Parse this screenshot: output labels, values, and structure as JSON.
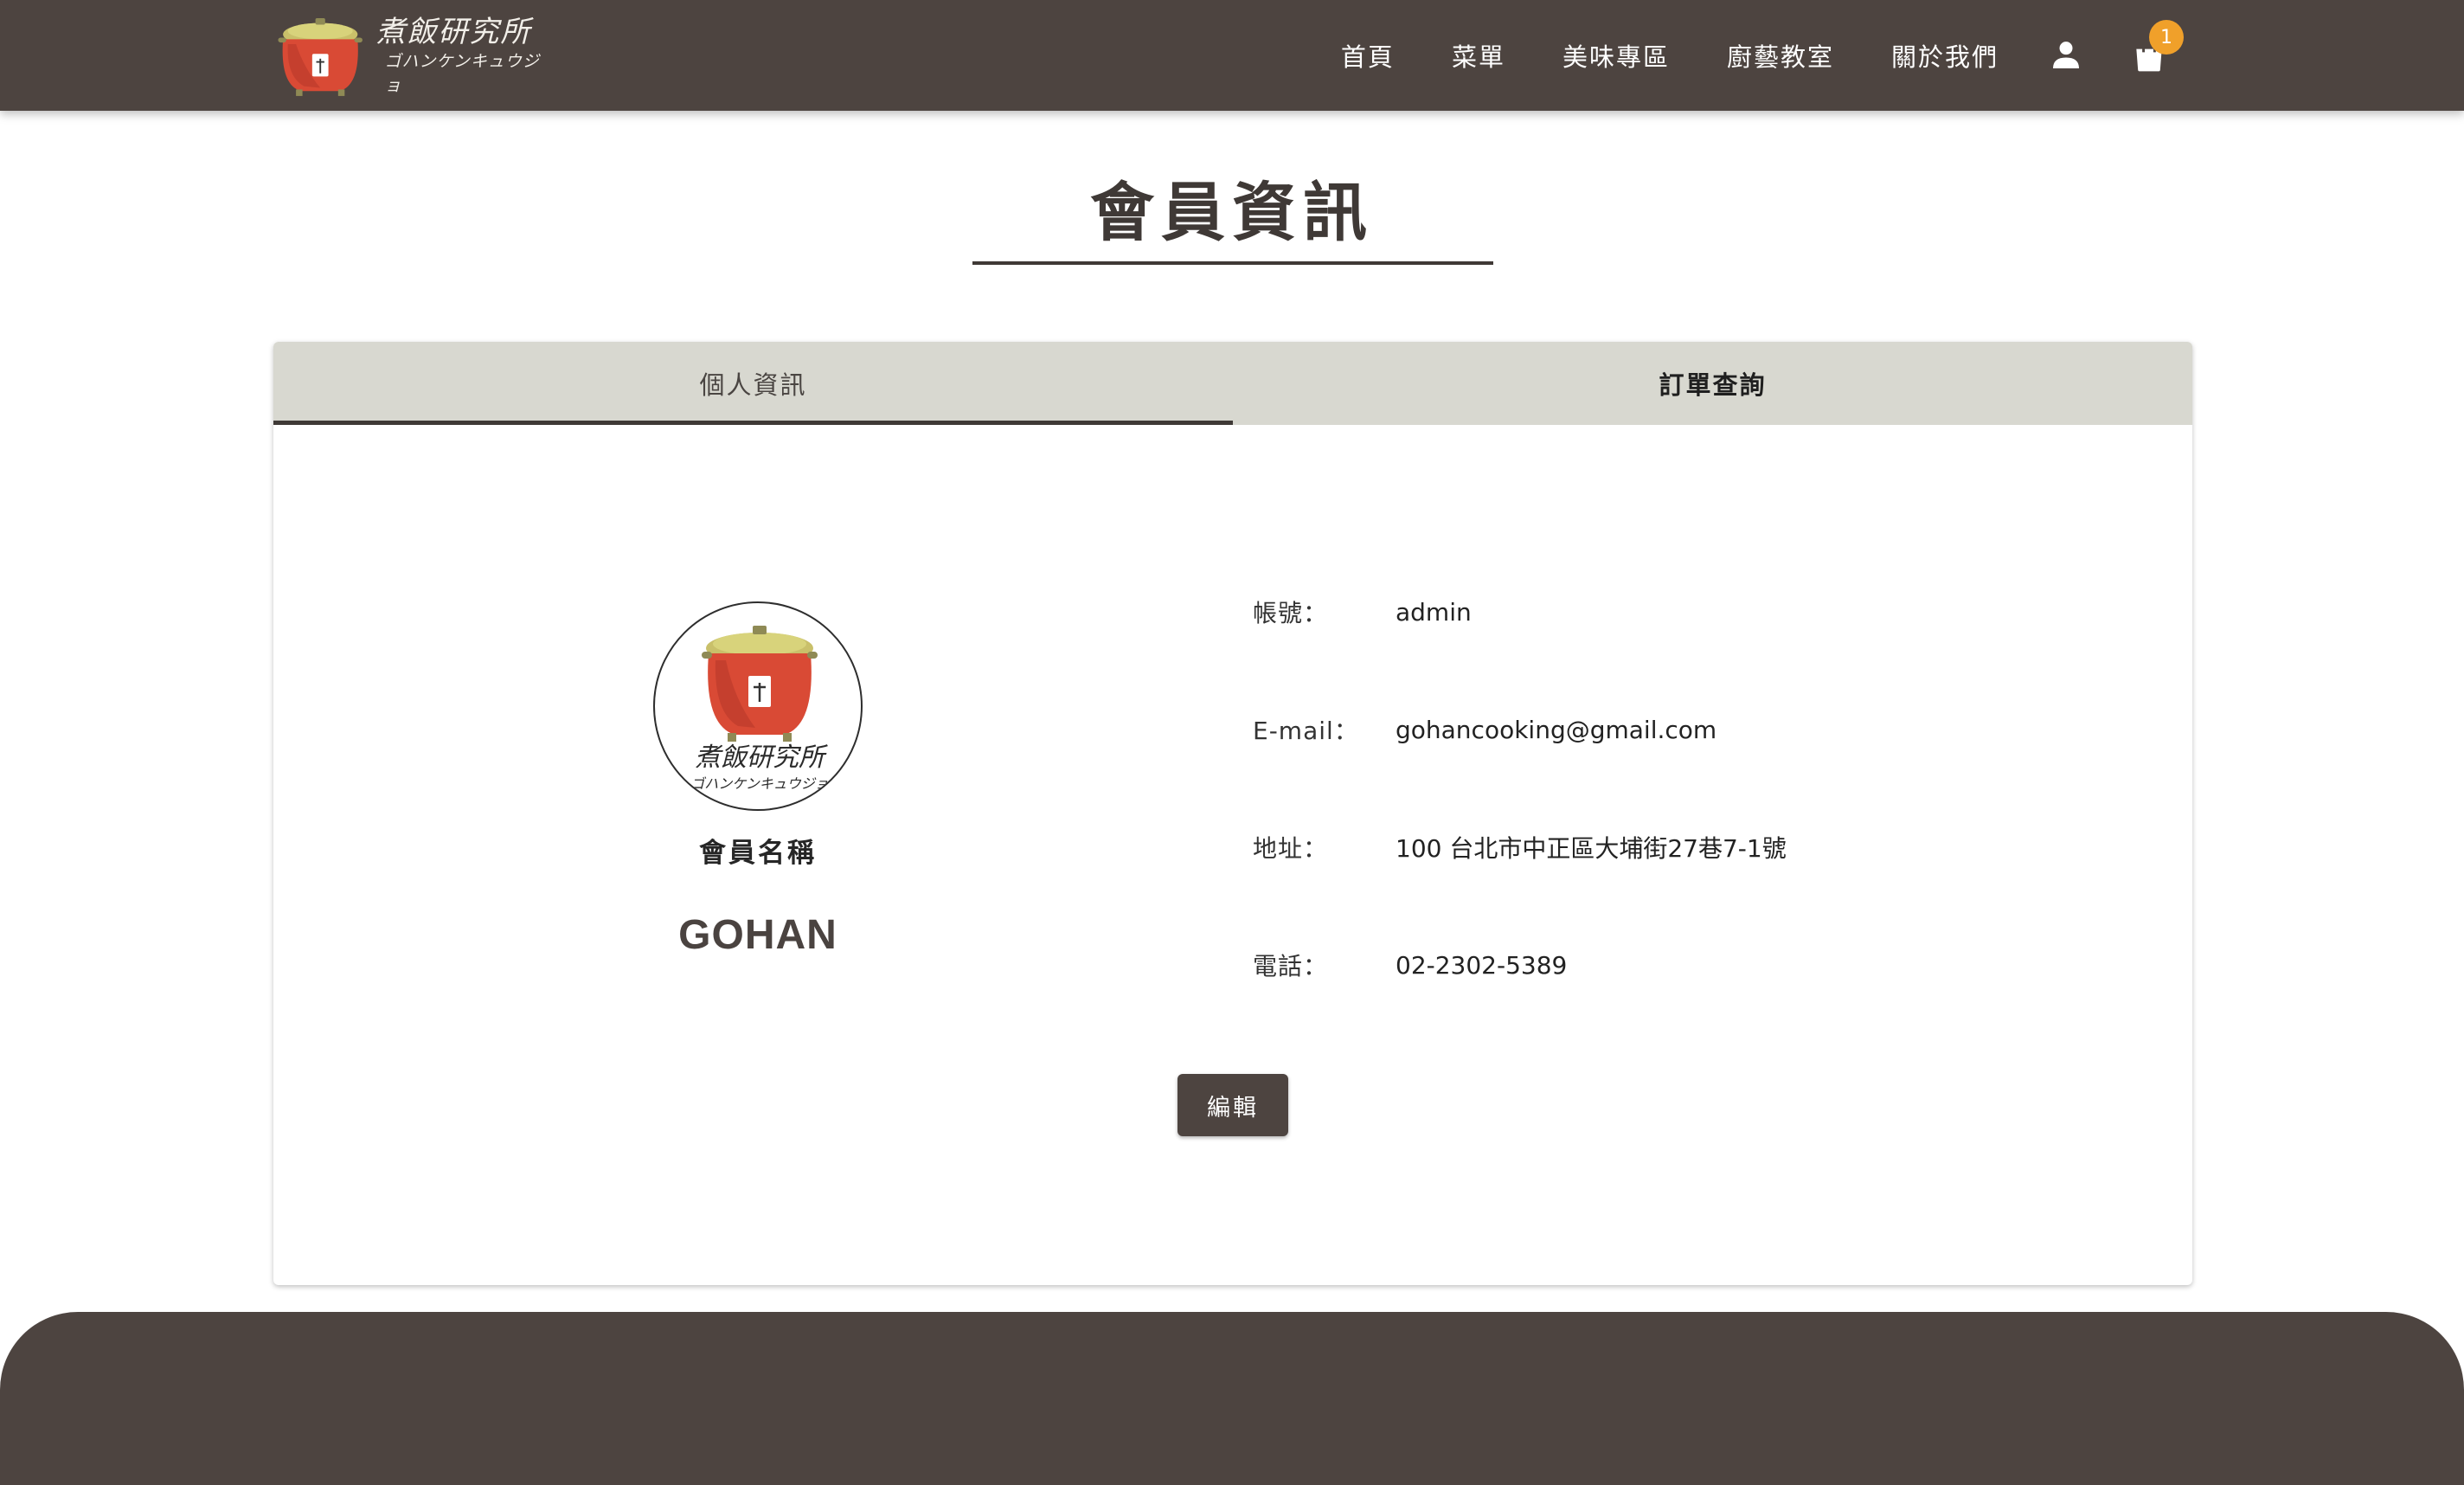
{
  "brand": {
    "name": "煮飯研究所",
    "name_kana": "ゴハンケンキュウジョ"
  },
  "nav": {
    "items": [
      "首頁",
      "菜單",
      "美味專區",
      "廚藝教室",
      "關於我們"
    ]
  },
  "cart": {
    "count": "1"
  },
  "page": {
    "title": "會員資訊"
  },
  "tabs": {
    "profile": "個人資訊",
    "orders": "訂單查詢"
  },
  "profile": {
    "member_label": "會員名稱",
    "member_name": "GOHAN",
    "fields": [
      {
        "label": "帳號：",
        "value": "admin"
      },
      {
        "label": "E-mail：",
        "value": "gohancooking@gmail.com"
      },
      {
        "label": "地址：",
        "value": "100 台北市中正區大埔街27巷7-1號"
      },
      {
        "label": "電話：",
        "value": "02-2302-5389"
      }
    ],
    "edit_label": "編輯"
  },
  "colors": {
    "header_bg": "#4d4440",
    "tabs_bg": "#d8d8d0",
    "badge": "#f0a02a",
    "pot_red": "#d94a35"
  },
  "icons": {
    "user": "user-icon",
    "cart": "shopping-bag-icon"
  }
}
